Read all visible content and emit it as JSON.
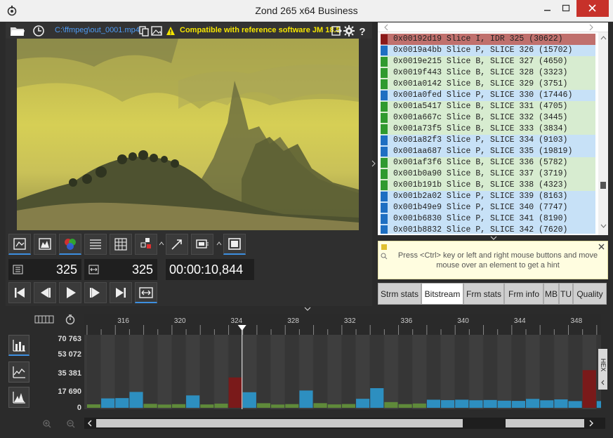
{
  "window": {
    "title": "Zond 265 x64 Business"
  },
  "toolbar": {
    "file_path": "C:\\ffmpeg\\out_0001.mp4",
    "compat_text": "Compatible with reference software JM 18.5"
  },
  "controls": {
    "frame_num_a": "325",
    "frame_num_b": "325",
    "timecode": "00:00:10,844"
  },
  "bitstream_list": [
    {
      "text": "0x00192d19 Slice I, IDR 325 (30622)",
      "type": "I"
    },
    {
      "text": "0x0019a4bb Slice P, SLICE 326 (15702)",
      "type": "P"
    },
    {
      "text": "0x0019e215 Slice B, SLICE 327 (4650)",
      "type": "B"
    },
    {
      "text": "0x0019f443 Slice B, SLICE 328 (3323)",
      "type": "B"
    },
    {
      "text": "0x001a0142 Slice B, SLICE 329 (3751)",
      "type": "B"
    },
    {
      "text": "0x001a0fed Slice P, SLICE 330 (17446)",
      "type": "P"
    },
    {
      "text": "0x001a5417 Slice B, SLICE 331 (4705)",
      "type": "B"
    },
    {
      "text": "0x001a667c Slice B, SLICE 332 (3445)",
      "type": "B"
    },
    {
      "text": "0x001a73f5 Slice B, SLICE 333 (3834)",
      "type": "B"
    },
    {
      "text": "0x001a82f3 Slice P, SLICE 334 (9103)",
      "type": "P"
    },
    {
      "text": "0x001aa687 Slice P, SLICE 335 (19819)",
      "type": "P"
    },
    {
      "text": "0x001af3f6 Slice B, SLICE 336 (5782)",
      "type": "B"
    },
    {
      "text": "0x001b0a90 Slice B, SLICE 337 (3719)",
      "type": "B"
    },
    {
      "text": "0x001b191b Slice B, SLICE 338 (4323)",
      "type": "B"
    },
    {
      "text": "0x001b2a02 Slice P, SLICE 339 (8163)",
      "type": "P"
    },
    {
      "text": "0x001b49e9 Slice P, SLICE 340 (7747)",
      "type": "P"
    },
    {
      "text": "0x001b6830 Slice P, SLICE 341 (8190)",
      "type": "P"
    },
    {
      "text": "0x001b8832 Slice P, SLICE 342 (7620)",
      "type": "P"
    }
  ],
  "slice_colors": {
    "I_bg": "#c0706d",
    "I_mark": "#8b1a1a",
    "P_bg": "#c7e1f7",
    "P_mark": "#1e6fc2",
    "B_bg": "#d7ecd0",
    "B_mark": "#2f9a2f"
  },
  "hint": {
    "text": "Press <Ctrl> key or left and right mouse buttons and move mouse over an element to get a hint"
  },
  "tabs": [
    {
      "label": "Strm stats",
      "active": false
    },
    {
      "label": "Bitstream",
      "active": true
    },
    {
      "label": "Frm stats",
      "active": false
    },
    {
      "label": "Frm info",
      "active": false
    },
    {
      "label": "MB",
      "active": false
    },
    {
      "label": "TU",
      "active": false
    },
    {
      "label": "Quality",
      "active": false
    }
  ],
  "timeline": {
    "ruler_ticks": [
      "316",
      "320",
      "324",
      "328",
      "332",
      "336",
      "340",
      "344",
      "348"
    ],
    "y_ticks": [
      "70 763",
      "53 072",
      "35 381",
      "17 690",
      "0"
    ],
    "side_label": "HEX"
  },
  "chart_data": {
    "type": "bar",
    "ylim": [
      0,
      70763
    ],
    "x": [
      314,
      315,
      316,
      317,
      318,
      319,
      320,
      321,
      322,
      323,
      324,
      325,
      326,
      327,
      328,
      329,
      330,
      331,
      332,
      333,
      334,
      335,
      336,
      337,
      338,
      339,
      340,
      341,
      342,
      343,
      344,
      345,
      346,
      347,
      348,
      349,
      350
    ],
    "values": [
      3500,
      9500,
      9800,
      16000,
      4000,
      3300,
      3700,
      12500,
      3400,
      4200,
      30622,
      15702,
      4650,
      3323,
      3751,
      17446,
      4705,
      3445,
      3834,
      9103,
      19819,
      5782,
      3719,
      4323,
      8163,
      7747,
      8190,
      7620,
      7900,
      7200,
      7000,
      9000,
      7600,
      8500,
      6800,
      38000,
      6800
    ],
    "types": [
      "B",
      "P",
      "P",
      "P",
      "B",
      "B",
      "B",
      "P",
      "B",
      "B",
      "I",
      "P",
      "B",
      "B",
      "B",
      "P",
      "B",
      "B",
      "B",
      "P",
      "P",
      "B",
      "B",
      "B",
      "P",
      "P",
      "P",
      "P",
      "P",
      "P",
      "P",
      "P",
      "P",
      "P",
      "P",
      "I",
      "P"
    ],
    "current": 325
  },
  "colors": {
    "bar_P": "#2d8fc0",
    "bar_B": "#5f8a3a",
    "bar_I": "#7a1a1a",
    "accent": "#3d8fe0"
  }
}
